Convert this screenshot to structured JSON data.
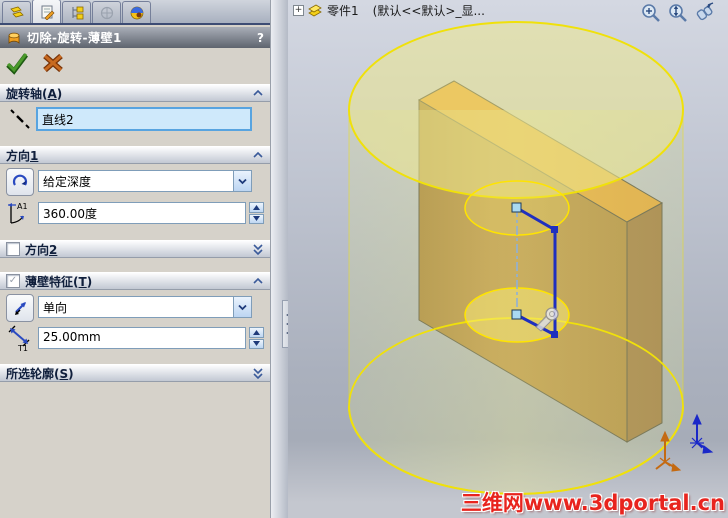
{
  "panel": {
    "title": "切除-旋转-薄壁1",
    "help_label": "?",
    "tabs": [
      "feature-manager-tree",
      "property-manager",
      "configuration-manager",
      "dimxpert-manager",
      "display-manager"
    ],
    "actions": {
      "ok": "确定",
      "cancel": "取消"
    },
    "sections": {
      "axis": {
        "prefix": "旋转轴(",
        "accel": "A",
        "suffix": ")",
        "value": "直线2",
        "expanded": true
      },
      "dir1": {
        "prefix": "方向",
        "accel": "1",
        "suffix": "",
        "type_value": "给定深度",
        "angle_value": "360.00度",
        "expanded": true
      },
      "dir2": {
        "prefix": "方向",
        "accel": "2",
        "suffix": "",
        "checked": false,
        "expanded": false
      },
      "thin": {
        "prefix": "薄壁特征(",
        "accel": "T",
        "suffix": ")",
        "check_glyph": "✓",
        "type_value": "单向",
        "thickness_value": "25.00mm",
        "checked": true,
        "expanded": true
      },
      "contours": {
        "prefix": "所选轮廓(",
        "accel": "S",
        "suffix": ")",
        "expanded": false
      }
    },
    "icons": {
      "axis_icon": "dash-dot-centerline",
      "revolve_direction_icon": "circular-arrow",
      "angle_icon_label": "A1",
      "thin_direction_icon": "reverse-arrows",
      "thickness_icon_label": "T1"
    }
  },
  "viewport": {
    "tree": {
      "expand_label": "+",
      "part": "零件1",
      "config": "(默认<<默认>_显..."
    },
    "tools": [
      "zoom-area",
      "zoom-in-out",
      "view-seek"
    ],
    "watermark": "三维网www.3dportal.cn",
    "scene": {
      "preview": "revolve-cut-cylinder",
      "sketch_axis": "直线2",
      "angle": "360.00度",
      "thin_wall": "25.00mm"
    }
  },
  "colors": {
    "preview_yellow": "#f0e10a",
    "box_top": "#eaa32e",
    "box_front": "#b48637",
    "box_side": "#9d7137",
    "sketch_profile": "#1f2fbf",
    "centerline": "#8fb0d8",
    "watermark_red": "#e8241e"
  }
}
